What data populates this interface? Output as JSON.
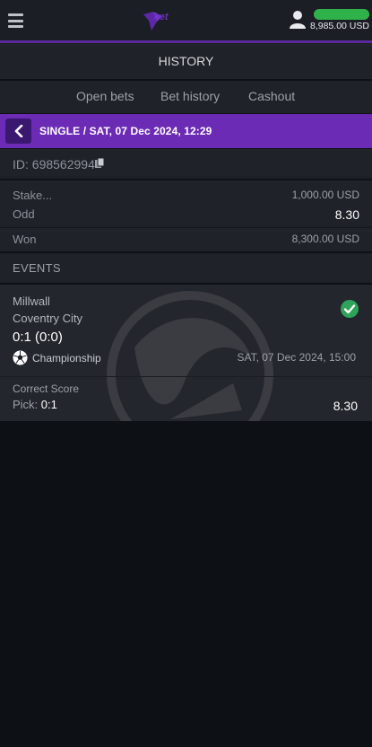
{
  "header": {
    "logo_text": "bet",
    "balance": "8,985.00 USD",
    "accent_color": "#6c2bb5",
    "balance_bar_color": "#2fb24a"
  },
  "page_title": "HISTORY",
  "tabs": [
    {
      "label": "Open bets"
    },
    {
      "label": "Bet history"
    },
    {
      "label": "Cashout"
    }
  ],
  "bet": {
    "header_text": "SINGLE / SAT,  07  Dec  2024,  12:29",
    "id_label": "ID:",
    "id_value": "698562994",
    "stake_label": "Stake...",
    "stake_value": "1,000.00  USD",
    "odd_label": "Odd",
    "odd_value": "8.30",
    "won_label": "Won",
    "won_value": "8,300.00  USD"
  },
  "events": {
    "title": "EVENTS",
    "items": [
      {
        "home": "Millwall",
        "away": "Coventry  City",
        "score": "0:1 (0:0)",
        "league": "Championship",
        "date": "SAT,  07  Dec  2024,  15:00",
        "market": "Correct Score",
        "pick_label": "Pick:",
        "pick_value": "0:1",
        "odd": "8.30",
        "status_icon": "check-circle-icon",
        "status_color": "#2fa35a"
      }
    ]
  }
}
